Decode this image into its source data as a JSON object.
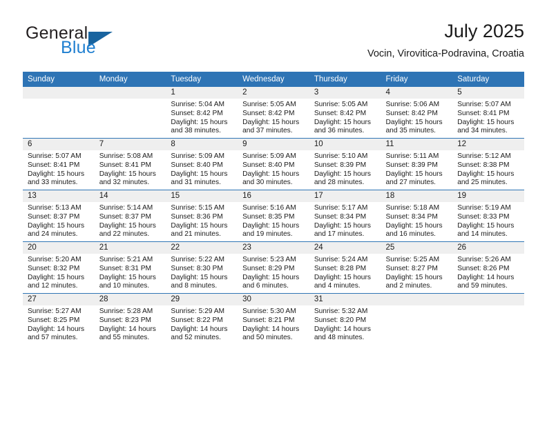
{
  "brand": {
    "line1": "General",
    "line2": "Blue",
    "flag_icon": "triangle-flag-icon",
    "colors": {
      "general": "#231f20",
      "blue": "#1f7fd0",
      "flag": "#19649f"
    }
  },
  "header": {
    "title": "July 2025",
    "subtitle": "Vocin, Virovitica-Podravina, Croatia"
  },
  "theme": {
    "header_bar": "#2e74b5",
    "daynum_band": "#efefef",
    "cell_bg": "#ffffff",
    "text": "#1a1a1a"
  },
  "calendar": {
    "weekday_headers": [
      "Sunday",
      "Monday",
      "Tuesday",
      "Wednesday",
      "Thursday",
      "Friday",
      "Saturday"
    ],
    "weeks": [
      [
        {
          "day": "",
          "blank": true
        },
        {
          "day": "",
          "blank": true
        },
        {
          "day": "1",
          "sunrise": "Sunrise: 5:04 AM",
          "sunset": "Sunset: 8:42 PM",
          "daylight": "Daylight: 15 hours and 38 minutes."
        },
        {
          "day": "2",
          "sunrise": "Sunrise: 5:05 AM",
          "sunset": "Sunset: 8:42 PM",
          "daylight": "Daylight: 15 hours and 37 minutes."
        },
        {
          "day": "3",
          "sunrise": "Sunrise: 5:05 AM",
          "sunset": "Sunset: 8:42 PM",
          "daylight": "Daylight: 15 hours and 36 minutes."
        },
        {
          "day": "4",
          "sunrise": "Sunrise: 5:06 AM",
          "sunset": "Sunset: 8:42 PM",
          "daylight": "Daylight: 15 hours and 35 minutes."
        },
        {
          "day": "5",
          "sunrise": "Sunrise: 5:07 AM",
          "sunset": "Sunset: 8:41 PM",
          "daylight": "Daylight: 15 hours and 34 minutes."
        }
      ],
      [
        {
          "day": "6",
          "sunrise": "Sunrise: 5:07 AM",
          "sunset": "Sunset: 8:41 PM",
          "daylight": "Daylight: 15 hours and 33 minutes."
        },
        {
          "day": "7",
          "sunrise": "Sunrise: 5:08 AM",
          "sunset": "Sunset: 8:41 PM",
          "daylight": "Daylight: 15 hours and 32 minutes."
        },
        {
          "day": "8",
          "sunrise": "Sunrise: 5:09 AM",
          "sunset": "Sunset: 8:40 PM",
          "daylight": "Daylight: 15 hours and 31 minutes."
        },
        {
          "day": "9",
          "sunrise": "Sunrise: 5:09 AM",
          "sunset": "Sunset: 8:40 PM",
          "daylight": "Daylight: 15 hours and 30 minutes."
        },
        {
          "day": "10",
          "sunrise": "Sunrise: 5:10 AM",
          "sunset": "Sunset: 8:39 PM",
          "daylight": "Daylight: 15 hours and 28 minutes."
        },
        {
          "day": "11",
          "sunrise": "Sunrise: 5:11 AM",
          "sunset": "Sunset: 8:39 PM",
          "daylight": "Daylight: 15 hours and 27 minutes."
        },
        {
          "day": "12",
          "sunrise": "Sunrise: 5:12 AM",
          "sunset": "Sunset: 8:38 PM",
          "daylight": "Daylight: 15 hours and 25 minutes."
        }
      ],
      [
        {
          "day": "13",
          "sunrise": "Sunrise: 5:13 AM",
          "sunset": "Sunset: 8:37 PM",
          "daylight": "Daylight: 15 hours and 24 minutes."
        },
        {
          "day": "14",
          "sunrise": "Sunrise: 5:14 AM",
          "sunset": "Sunset: 8:37 PM",
          "daylight": "Daylight: 15 hours and 22 minutes."
        },
        {
          "day": "15",
          "sunrise": "Sunrise: 5:15 AM",
          "sunset": "Sunset: 8:36 PM",
          "daylight": "Daylight: 15 hours and 21 minutes."
        },
        {
          "day": "16",
          "sunrise": "Sunrise: 5:16 AM",
          "sunset": "Sunset: 8:35 PM",
          "daylight": "Daylight: 15 hours and 19 minutes."
        },
        {
          "day": "17",
          "sunrise": "Sunrise: 5:17 AM",
          "sunset": "Sunset: 8:34 PM",
          "daylight": "Daylight: 15 hours and 17 minutes."
        },
        {
          "day": "18",
          "sunrise": "Sunrise: 5:18 AM",
          "sunset": "Sunset: 8:34 PM",
          "daylight": "Daylight: 15 hours and 16 minutes."
        },
        {
          "day": "19",
          "sunrise": "Sunrise: 5:19 AM",
          "sunset": "Sunset: 8:33 PM",
          "daylight": "Daylight: 15 hours and 14 minutes."
        }
      ],
      [
        {
          "day": "20",
          "sunrise": "Sunrise: 5:20 AM",
          "sunset": "Sunset: 8:32 PM",
          "daylight": "Daylight: 15 hours and 12 minutes."
        },
        {
          "day": "21",
          "sunrise": "Sunrise: 5:21 AM",
          "sunset": "Sunset: 8:31 PM",
          "daylight": "Daylight: 15 hours and 10 minutes."
        },
        {
          "day": "22",
          "sunrise": "Sunrise: 5:22 AM",
          "sunset": "Sunset: 8:30 PM",
          "daylight": "Daylight: 15 hours and 8 minutes."
        },
        {
          "day": "23",
          "sunrise": "Sunrise: 5:23 AM",
          "sunset": "Sunset: 8:29 PM",
          "daylight": "Daylight: 15 hours and 6 minutes."
        },
        {
          "day": "24",
          "sunrise": "Sunrise: 5:24 AM",
          "sunset": "Sunset: 8:28 PM",
          "daylight": "Daylight: 15 hours and 4 minutes."
        },
        {
          "day": "25",
          "sunrise": "Sunrise: 5:25 AM",
          "sunset": "Sunset: 8:27 PM",
          "daylight": "Daylight: 15 hours and 2 minutes."
        },
        {
          "day": "26",
          "sunrise": "Sunrise: 5:26 AM",
          "sunset": "Sunset: 8:26 PM",
          "daylight": "Daylight: 14 hours and 59 minutes."
        }
      ],
      [
        {
          "day": "27",
          "sunrise": "Sunrise: 5:27 AM",
          "sunset": "Sunset: 8:25 PM",
          "daylight": "Daylight: 14 hours and 57 minutes."
        },
        {
          "day": "28",
          "sunrise": "Sunrise: 5:28 AM",
          "sunset": "Sunset: 8:23 PM",
          "daylight": "Daylight: 14 hours and 55 minutes."
        },
        {
          "day": "29",
          "sunrise": "Sunrise: 5:29 AM",
          "sunset": "Sunset: 8:22 PM",
          "daylight": "Daylight: 14 hours and 52 minutes."
        },
        {
          "day": "30",
          "sunrise": "Sunrise: 5:30 AM",
          "sunset": "Sunset: 8:21 PM",
          "daylight": "Daylight: 14 hours and 50 minutes."
        },
        {
          "day": "31",
          "sunrise": "Sunrise: 5:32 AM",
          "sunset": "Sunset: 8:20 PM",
          "daylight": "Daylight: 14 hours and 48 minutes."
        },
        {
          "day": "",
          "blank": true
        },
        {
          "day": "",
          "blank": true
        }
      ]
    ]
  }
}
